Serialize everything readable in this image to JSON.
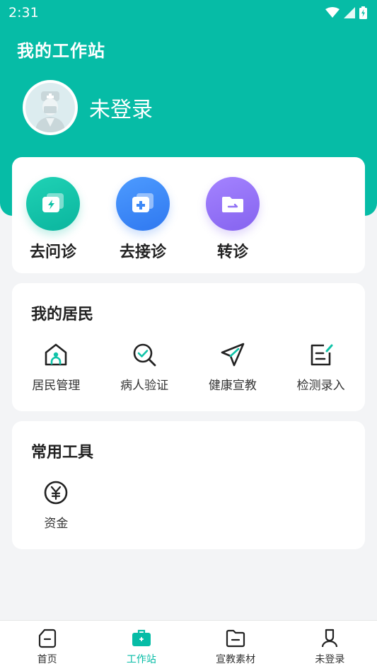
{
  "status_bar": {
    "time": "2:31"
  },
  "header": {
    "title": "我的工作站",
    "user_name": "未登录"
  },
  "quick_actions": [
    {
      "label": "去问诊",
      "icon": "lightning-chat-icon",
      "color": "#10c3a8"
    },
    {
      "label": "去接诊",
      "icon": "plus-chat-icon",
      "color": "#3d89f7"
    },
    {
      "label": "转诊",
      "icon": "folder-transfer-icon",
      "color": "#9273f5"
    }
  ],
  "residents": {
    "title": "我的居民",
    "items": [
      {
        "label": "居民管理",
        "icon": "home-person-icon"
      },
      {
        "label": "病人验证",
        "icon": "search-check-icon"
      },
      {
        "label": "健康宣教",
        "icon": "send-icon"
      },
      {
        "label": "检测录入",
        "icon": "edit-note-icon"
      }
    ]
  },
  "tools": {
    "title": "常用工具",
    "items": [
      {
        "label": "资金",
        "icon": "yuan-icon"
      }
    ]
  },
  "bottom_nav": [
    {
      "label": "首页",
      "icon": "home-icon",
      "active": false
    },
    {
      "label": "工作站",
      "icon": "briefcase-icon",
      "active": true
    },
    {
      "label": "宣教素材",
      "icon": "folder-icon",
      "active": false
    },
    {
      "label": "未登录",
      "icon": "profile-icon",
      "active": false
    }
  ],
  "colors": {
    "accent": "#06bca6",
    "background": "#f3f4f6"
  }
}
